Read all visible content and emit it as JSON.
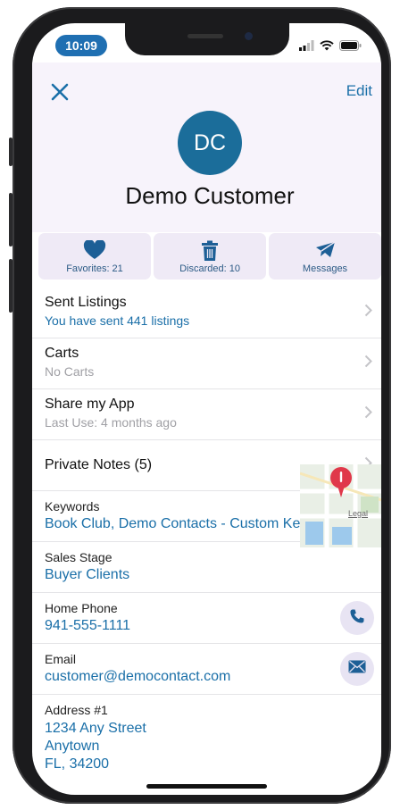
{
  "status": {
    "time": "10:09"
  },
  "header": {
    "edit_label": "Edit",
    "avatar_initials": "DC",
    "name": "Demo Customer"
  },
  "actions": [
    {
      "label": "Favorites: 21",
      "icon": "heart-icon"
    },
    {
      "label": "Discarded: 10",
      "icon": "trash-icon"
    },
    {
      "label": "Messages",
      "icon": "messages-icon"
    }
  ],
  "rows": {
    "sent": {
      "title": "Sent Listings",
      "sub": "You have sent 441 listings"
    },
    "carts": {
      "title": "Carts",
      "sub": "No Carts"
    },
    "share": {
      "title": "Share my App",
      "sub": "Last Use: 4 months ago"
    },
    "notes": {
      "title": "Private Notes (5)"
    }
  },
  "info": {
    "keywords": {
      "label": "Keywords",
      "value": "Book Club, Demo Contacts - Custom Keyword"
    },
    "stage": {
      "label": "Sales Stage",
      "value": "Buyer Clients"
    },
    "phone": {
      "label": "Home Phone",
      "value": "941-555-1111"
    },
    "email": {
      "label": "Email",
      "value": "customer@democontact.com"
    },
    "address": {
      "label": "Address #1",
      "line1": "1234 Any Street",
      "line2": "Anytown",
      "line3": "FL, 34200"
    }
  },
  "map": {
    "legal": "Legal"
  },
  "colors": {
    "accent": "#1a6fa8",
    "avatar": "#1b6d9a",
    "pin": "#e0384a"
  }
}
